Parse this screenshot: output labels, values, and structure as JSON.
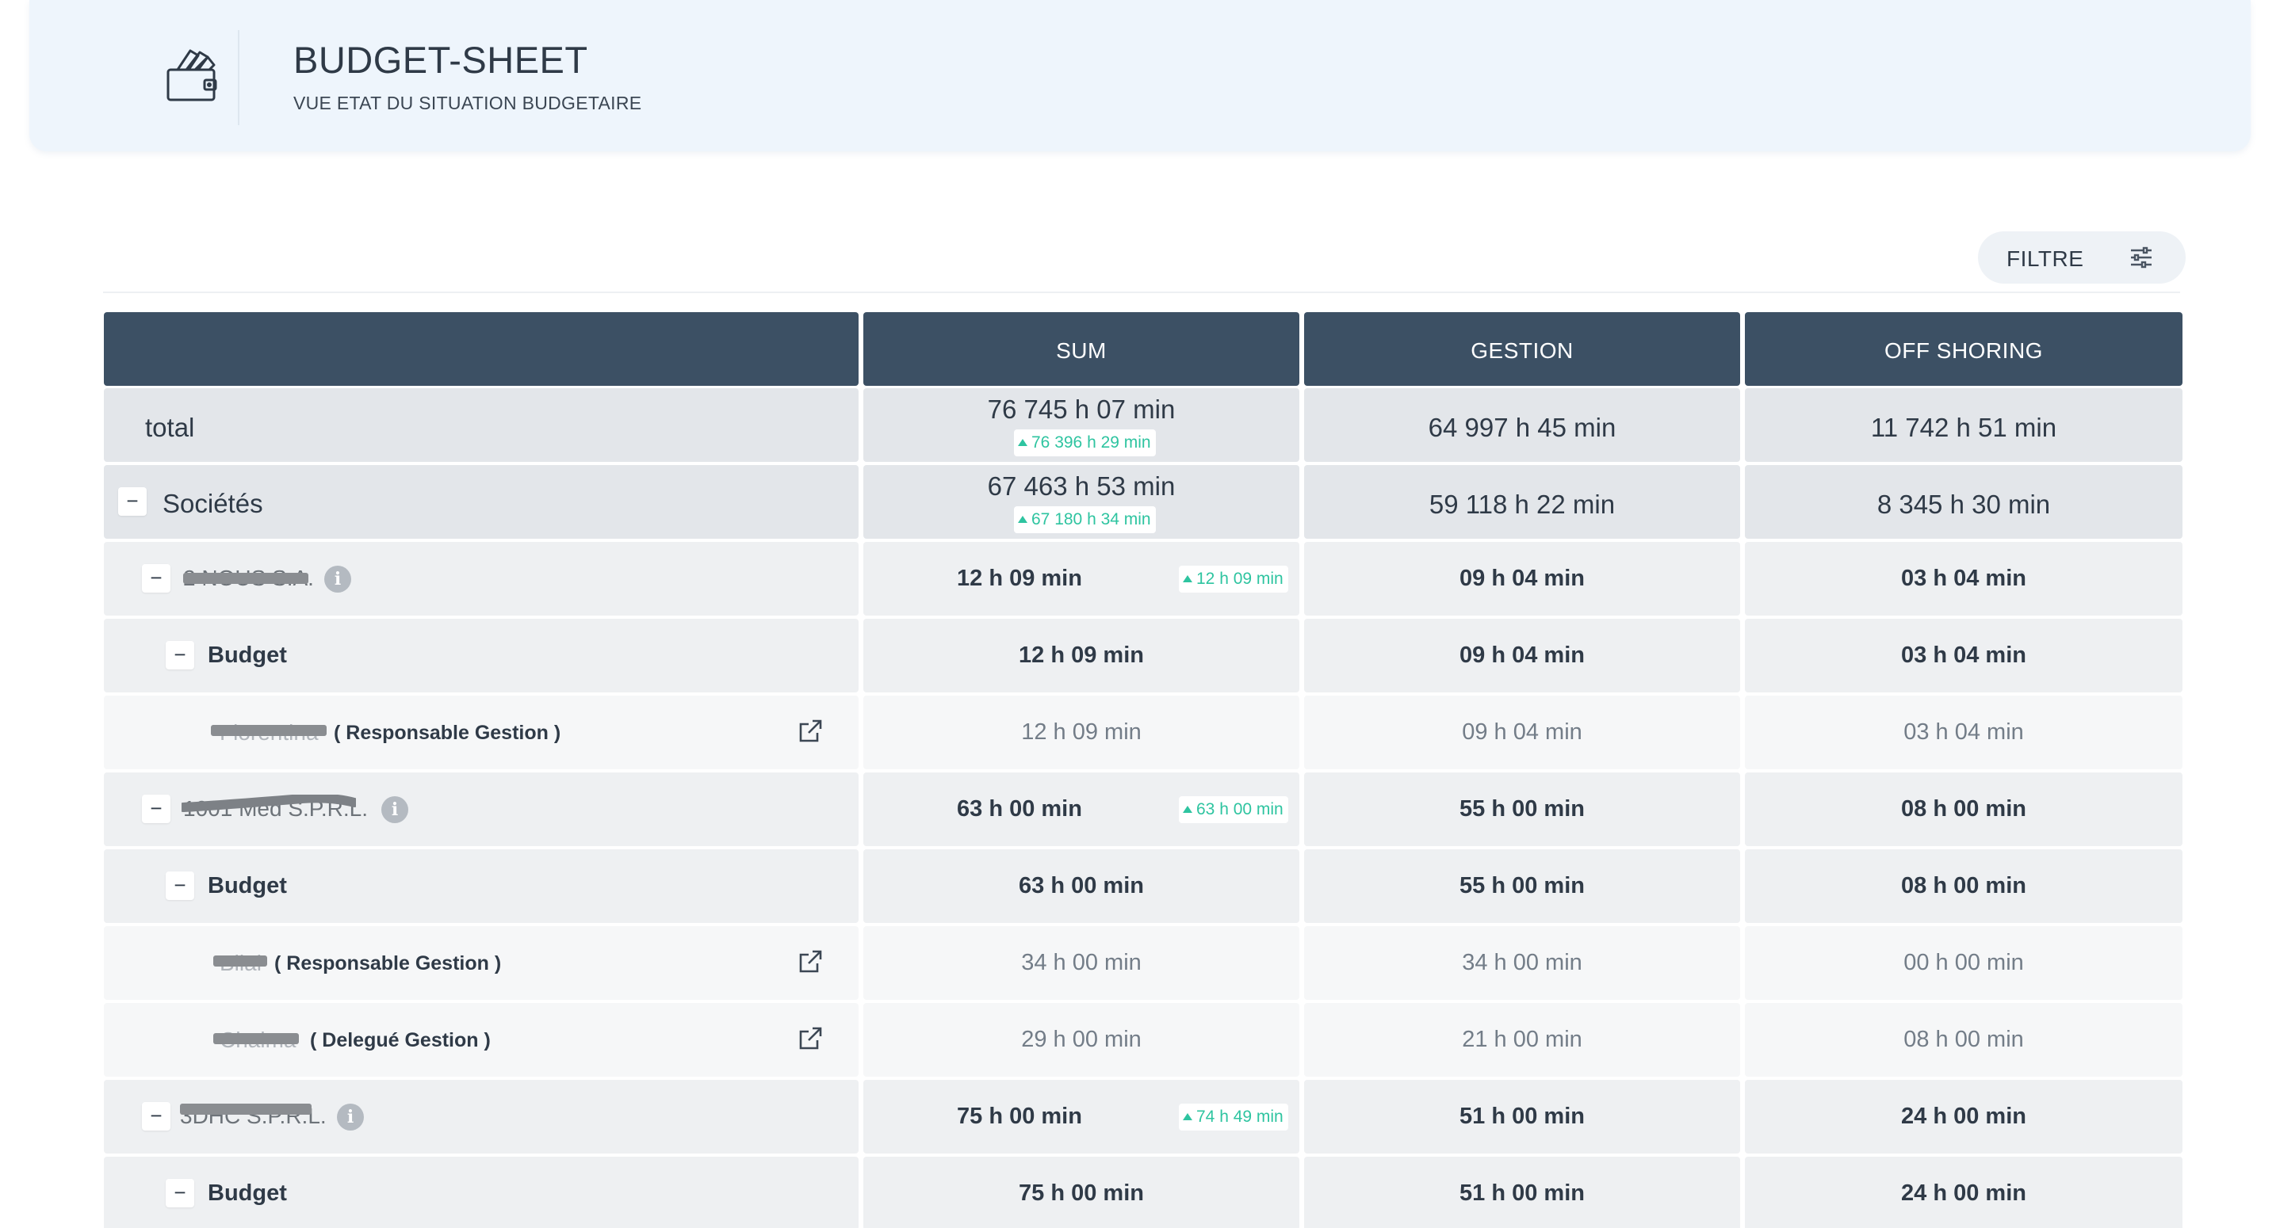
{
  "header": {
    "title": "BUDGET-SHEET",
    "subtitle": "VUE ETAT DU SITUATION BUDGETAIRE",
    "icon": "wallet-cards-icon"
  },
  "filter": {
    "label": "FILTRE",
    "icon": "sliders-icon"
  },
  "table": {
    "columns": [
      "",
      "SUM",
      "GESTION",
      "OFF SHORING"
    ],
    "rows": [
      {
        "label": "total",
        "sum": "76 745 h 07 min",
        "trend": "76 396 h 29 min",
        "gestion": "64 997 h 45 min",
        "offshoring": "11 742 h 51 min"
      },
      {
        "label": "Sociétés",
        "toggle": "−",
        "sum": "67 463 h 53 min",
        "trend": "67 180 h 34 min",
        "gestion": "59 118 h 22 min",
        "offshoring": "8 345 h 30 min"
      },
      {
        "label": "2 NOUS S.A.",
        "toggle": "−",
        "info": "i",
        "sum": "12 h 09 min",
        "trend": "12 h 09 min",
        "gestion": "09 h 04 min",
        "offshoring": "03 h 04 min"
      },
      {
        "label": "Budget",
        "toggle": "−",
        "sum": "12 h 09 min",
        "gestion": "09 h 04 min",
        "offshoring": "03 h 04 min"
      },
      {
        "name": "Florentina",
        "role": "( Responsable Gestion )",
        "sum": "12 h 09 min",
        "gestion": "09 h 04 min",
        "offshoring": "03 h 04 min"
      },
      {
        "label": "1001 Med S.P.R.L.",
        "toggle": "−",
        "info": "i",
        "sum": "63 h 00 min",
        "trend": "63 h 00 min",
        "gestion": "55 h 00 min",
        "offshoring": "08 h 00 min"
      },
      {
        "label": "Budget",
        "toggle": "−",
        "sum": "63 h 00 min",
        "gestion": "55 h 00 min",
        "offshoring": "08 h 00 min"
      },
      {
        "name": "Bilal",
        "role": "( Responsable Gestion )",
        "sum": "34 h 00 min",
        "gestion": "34 h 00 min",
        "offshoring": "00 h 00 min"
      },
      {
        "name": "Chaima",
        "role": "( Delegué Gestion )",
        "sum": "29 h 00 min",
        "gestion": "21 h 00 min",
        "offshoring": "08 h 00 min"
      },
      {
        "label": "3DHC S.P.R.L.",
        "toggle": "−",
        "info": "i",
        "sum": "75 h 00 min",
        "trend": "74 h 49 min",
        "gestion": "51 h 00 min",
        "offshoring": "24 h 00 min"
      },
      {
        "label": "Budget",
        "toggle": "−",
        "sum": "75 h 00 min",
        "gestion": "51 h 00 min",
        "offshoring": "24 h 00 min"
      }
    ]
  },
  "colors": {
    "header_bg": "#3c5064",
    "trend": "#2ec4a0",
    "banner_bg": "#eef5fc"
  }
}
